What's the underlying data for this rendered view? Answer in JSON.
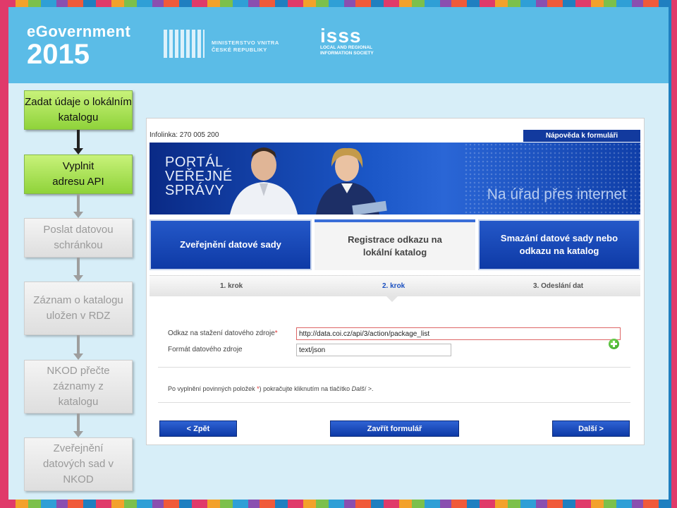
{
  "header": {
    "event_line1": "eGovernment",
    "event_year": "2015",
    "ministry_line1": "MINISTERSTVO VNITRA",
    "ministry_line2": "ČESKÉ REPUBLIKY",
    "isss_logo": "isss",
    "isss_sub1": "LOCAL AND REGIONAL",
    "isss_sub2": "INFORMATION SOCIETY"
  },
  "flow": {
    "steps": [
      {
        "label": "Zadat údaje o lokálním katalogu",
        "state": "active"
      },
      {
        "label": "Vyplnit adresu API",
        "state": "active"
      },
      {
        "label": "Poslat datovou schránkou",
        "state": "pending"
      },
      {
        "label": "Záznam o katalogu uložen v RDZ",
        "state": "pending"
      },
      {
        "label": "NKOD přečte záznamy z katalogu",
        "state": "pending"
      },
      {
        "label": "Zveřejnění datových sad v NKOD",
        "state": "pending"
      }
    ]
  },
  "portal": {
    "infolinka": "Infolinka: 270 005 200",
    "help_button": "Nápověda k formuláři",
    "hero_title_1": "PORTÁL",
    "hero_title_2": "VEŘEJNÉ",
    "hero_title_3": "SPRÁVY",
    "hero_slogan": "Na úřad přes internet",
    "tabs": [
      {
        "label": "Zveřejnění datové sady"
      },
      {
        "label": "Registrace odkazu na lokální katalog"
      },
      {
        "label": "Smazání datové sady nebo odkazu na katalog"
      }
    ],
    "steps": [
      "1. krok",
      "2. krok",
      "3. Odeslání dat"
    ],
    "form": {
      "url_label": "Odkaz na stažení datového zdroje",
      "url_required": "*",
      "url_value": "http://data.coi.cz/api/3/action/package_list",
      "format_label": "Formát datového zdroje",
      "format_value": "text/json"
    },
    "note_prefix": "Po vyplnění povinných položek ",
    "note_mark": "*",
    "note_mid": ") pokračujte kliknutím na tlačítko ",
    "note_button_ref": "Další >",
    "note_suffix": ".",
    "buttons": {
      "back": "< Zpět",
      "close": "Zavřít formulář",
      "next": "Další >"
    }
  },
  "colors": {
    "banner": "#5bbce7",
    "active_box": "#a6e04f",
    "portal_blue": "#0e3aa6"
  }
}
